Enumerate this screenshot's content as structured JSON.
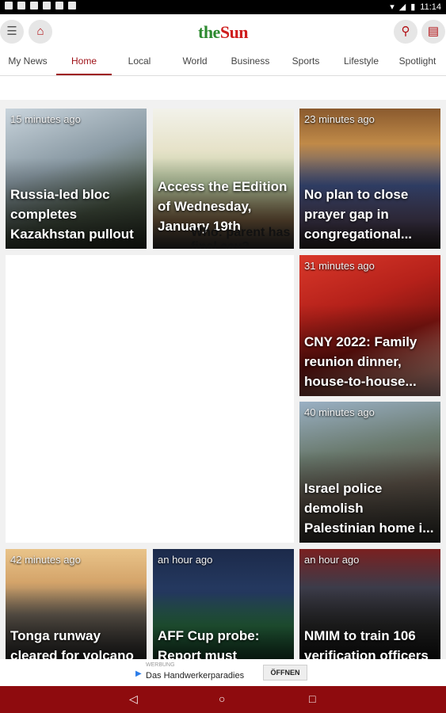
{
  "status_bar": {
    "time": "11:14"
  },
  "header": {
    "menu_icon": "hamburger-icon",
    "home_icon": "home-icon",
    "logo_part1": "the",
    "logo_part2": "Sun",
    "search_icon": "search-icon",
    "sections_icon": "grid-menu-icon"
  },
  "tabs": [
    {
      "label": "My News"
    },
    {
      "label": "Home"
    },
    {
      "label": "Local"
    },
    {
      "label": "World"
    },
    {
      "label": "Business"
    },
    {
      "label": "Sports"
    },
    {
      "label": "Lifestyle"
    },
    {
      "label": "Spotlight"
    }
  ],
  "active_tab": "Home",
  "cards": [
    {
      "time": "15 minutes ago",
      "title": "Russia-led bloc completes Kazakhstan pullout"
    },
    {
      "time": "",
      "title": "Access the EEdition of Wednesday, January 19th",
      "overlay_text": "Who: parent has final say?"
    },
    {
      "time": "23 minutes ago",
      "title": "No plan to close prayer gap in congregational..."
    },
    {
      "time": "31 minutes ago",
      "title": "CNY 2022: Family reunion dinner, house-to-house..."
    },
    {
      "time": "40 minutes ago",
      "title": "Israel police demolish Palestinian home i..."
    },
    {
      "time": "42 minutes ago",
      "title": "Tonga runway cleared for volcano"
    },
    {
      "time": "an hour ago",
      "title": "AFF Cup probe: Report must"
    },
    {
      "time": "an hour ago",
      "title": "NMIM to train 106 verification officers"
    }
  ],
  "ad": {
    "tag": "WERBUNG",
    "text": "Das Handwerkerparadies",
    "button": "ÖFFNEN"
  },
  "nav": {
    "back_icon": "back-icon",
    "home_icon": "home-circle-icon",
    "recents_icon": "recents-square-icon"
  },
  "colors": {
    "brand": "#9e0f15",
    "nav_bg": "#8e0b0e",
    "logo_green": "#2c8a2f",
    "logo_red": "#cf1d1d"
  }
}
